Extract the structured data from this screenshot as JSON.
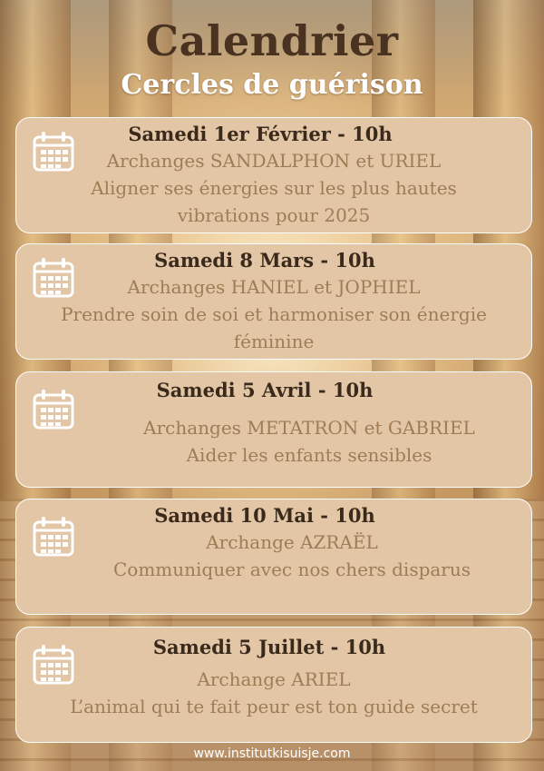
{
  "header": {
    "title": "Calendrier",
    "subtitle": "Cercles de guérison"
  },
  "events": [
    {
      "date": "Samedi 1er Février  - 10h",
      "archangels": "Archanges SANDALPHON et URIEL",
      "theme_line1": "Aligner ses énergies sur les plus hautes",
      "theme_line2": "vibrations pour 2025"
    },
    {
      "date": "Samedi 8 Mars - 10h",
      "archangels": "Archanges HANIEL et JOPHIEL",
      "theme_line1": "Prendre soin de soi et harmoniser son énergie",
      "theme_line2": "féminine"
    },
    {
      "date": "Samedi 5 Avril - 10h",
      "archangels": "Archanges METATRON et GABRIEL",
      "theme_line1": "Aider les enfants sensibles"
    },
    {
      "date": "Samedi 10 Mai - 10h",
      "archangels": "Archange AZRAËL",
      "theme_line1": "Communiquer avec nos chers disparus"
    },
    {
      "date": "Samedi 5 Juillet - 10h",
      "archangels": "Archange ARIEL",
      "theme_line1": "L’animal qui te fait peur est ton guide secret"
    }
  ],
  "footer": {
    "website": "www.institutkisuisje.com"
  },
  "colors": {
    "title": "#4a3221",
    "card_background": "#e2c6a5",
    "card_border": "#ffffff",
    "date_text": "#3a2a1c",
    "detail_text": "#9f7c56"
  },
  "icons": {
    "event_icon": "calendar-icon"
  }
}
